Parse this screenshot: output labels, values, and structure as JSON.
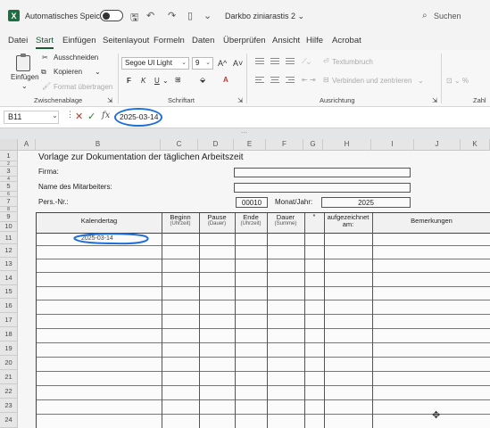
{
  "titlebar": {
    "autosave_label": "Automatisches Speichern",
    "doc_title": "Darkbo ziniarastis 2 ⌄",
    "search": "Suchen"
  },
  "menu": {
    "tabs": [
      "Datei",
      "Start",
      "Einfügen",
      "Seitenlayout",
      "Formeln",
      "Daten",
      "Überprüfen",
      "Ansicht",
      "Hilfe",
      "Acrobat"
    ],
    "active": "Start"
  },
  "ribbon": {
    "paste": "Einfügen",
    "cut": "Ausschneiden",
    "copy": "Kopieren",
    "format_painter": "Format übertragen",
    "clipboard_group": "Zwischenablage",
    "font_name": "Segoe UI Light",
    "font_size": "9",
    "grow": "A^",
    "shrink": "A˅",
    "bold": "F",
    "italic": "K",
    "underline": "U",
    "font_group": "Schriftart",
    "wrap": "Textumbruch",
    "merge": "Verbinden und zentrieren",
    "alignment_group": "Ausrichtung",
    "number_group": "Zahl"
  },
  "formula_bar": {
    "name_box": "B11",
    "fx": "fx",
    "value": "2025-03-14"
  },
  "sheet": {
    "columns": [
      "A",
      "B",
      "C",
      "D",
      "E",
      "F",
      "G",
      "H",
      "I",
      "J",
      "K"
    ],
    "rows": [
      "1",
      "2",
      "3",
      "4",
      "5",
      "6",
      "7",
      "8",
      "9",
      "10",
      "11",
      "12",
      "13",
      "14",
      "15",
      "16",
      "17",
      "18",
      "19",
      "20",
      "21",
      "22",
      "23",
      "24"
    ],
    "title": "Vorlage zur Dokumentation der täglichen Arbeitszeit",
    "firma_label": "Firma:",
    "mitarbeiter_label": "Name des Mitarbeiters:",
    "persnr_label": "Pers.-Nr.:",
    "persnr_value": "00010",
    "monat_label": "Monat/Jahr:",
    "monat_value": "2025",
    "table": {
      "headers": {
        "kalendertag": "Kalendertag",
        "beginn": "Beginn",
        "beginn_sub": "(Uhrzeit)",
        "pause": "Pause",
        "pause_sub": "(Dauer)",
        "ende": "Ende",
        "ende_sub": "(Uhrzeit)",
        "dauer": "Dauer",
        "dauer_sub": "(Summe)",
        "star": "*",
        "aufgezeichnet": "aufgezeichnet am:",
        "bemerkungen": "Bemerkungen"
      },
      "first_date": "2025-03-14"
    }
  },
  "colors": {
    "excel_green": "#1d6f42",
    "ink_blue": "#1e6fd9"
  }
}
